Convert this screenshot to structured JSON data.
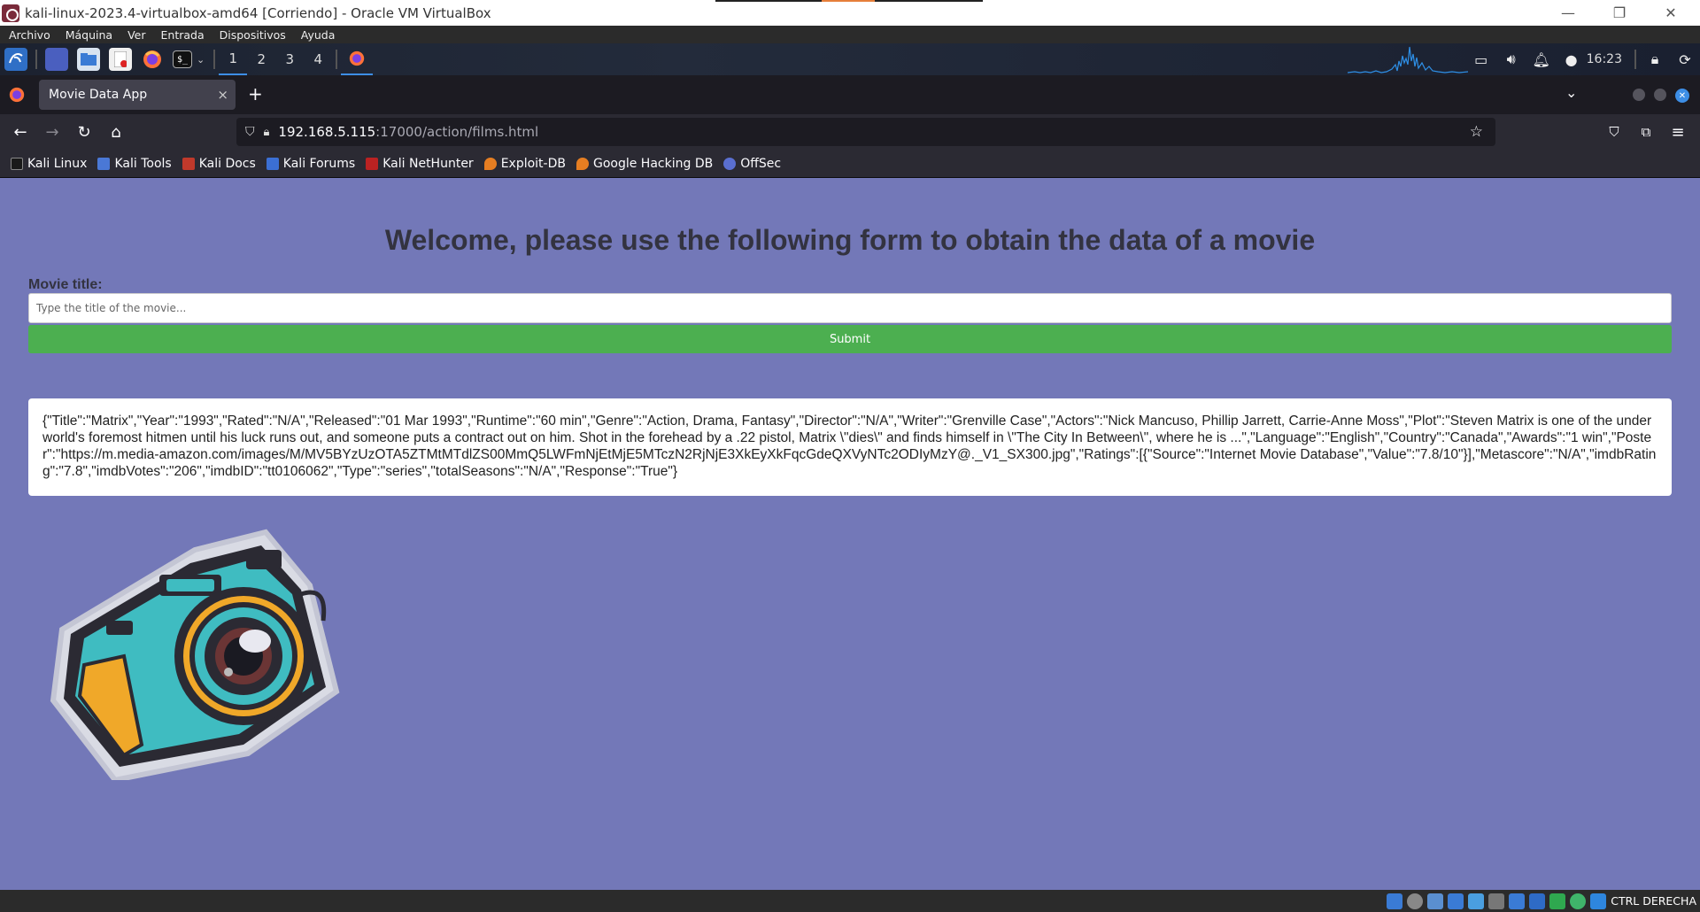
{
  "window": {
    "title": "kali-linux-2023.4-virtualbox-amd64 [Corriendo] - Oracle VM VirtualBox",
    "minimize_glyph": "—",
    "restore_glyph": "❐",
    "close_glyph": "✕"
  },
  "vbox_menu": [
    "Archivo",
    "Máquina",
    "Ver",
    "Entrada",
    "Dispositivos",
    "Ayuda"
  ],
  "panel": {
    "workspaces": [
      "1",
      "2",
      "3",
      "4"
    ],
    "active_workspace": "1",
    "clock": "16:23"
  },
  "browser": {
    "tab_title": "Movie Data App",
    "tab_close": "×",
    "new_tab": "+",
    "url_host": "192.168.5.115",
    "url_path": ":17000/action/films.html",
    "bookmarks": [
      "Kali Linux",
      "Kali Tools",
      "Kali Docs",
      "Kali Forums",
      "Kali NetHunter",
      "Exploit-DB",
      "Google Hacking DB",
      "OffSec"
    ]
  },
  "page": {
    "heading": "Welcome, please use the following form to obtain the data of a movie",
    "label": "Movie title:",
    "input_placeholder": "Type the title of the movie...",
    "input_value": "",
    "submit_label": "Submit",
    "result_text": "{\"Title\":\"Matrix\",\"Year\":\"1993\",\"Rated\":\"N/A\",\"Released\":\"01 Mar 1993\",\"Runtime\":\"60 min\",\"Genre\":\"Action, Drama, Fantasy\",\"Director\":\"N/A\",\"Writer\":\"Grenville Case\",\"Actors\":\"Nick Mancuso, Phillip Jarrett, Carrie-Anne Moss\",\"Plot\":\"Steven Matrix is one of the underworld's foremost hitmen until his luck runs out, and someone puts a contract out on him. Shot in the forehead by a .22 pistol, Matrix \\\"dies\\\" and finds himself in \\\"The City In Between\\\", where he is ...\",\"Language\":\"English\",\"Country\":\"Canada\",\"Awards\":\"1 win\",\"Poster\":\"https://m.media-amazon.com/images/M/MV5BYzUzOTA5ZTMtMTdlZS00MmQ5LWFmNjEtMjE5MTczN2RjNjE3XkEyXkFqcGdeQXVyNTc2ODIyMzY@._V1_SX300.jpg\",\"Ratings\":[{\"Source\":\"Internet Movie Database\",\"Value\":\"7.8/10\"}],\"Metascore\":\"N/A\",\"imdbRating\":\"7.8\",\"imdbVotes\":\"206\",\"imdbID\":\"tt0106062\",\"Type\":\"series\",\"totalSeasons\":\"N/A\",\"Response\":\"True\"}"
  },
  "statusbar": {
    "host_key": "CTRL DERECHA"
  },
  "colors": {
    "page_bg": "#7378b8",
    "submit_bg": "#4caf50",
    "accent_blue": "#3d8ee6"
  }
}
